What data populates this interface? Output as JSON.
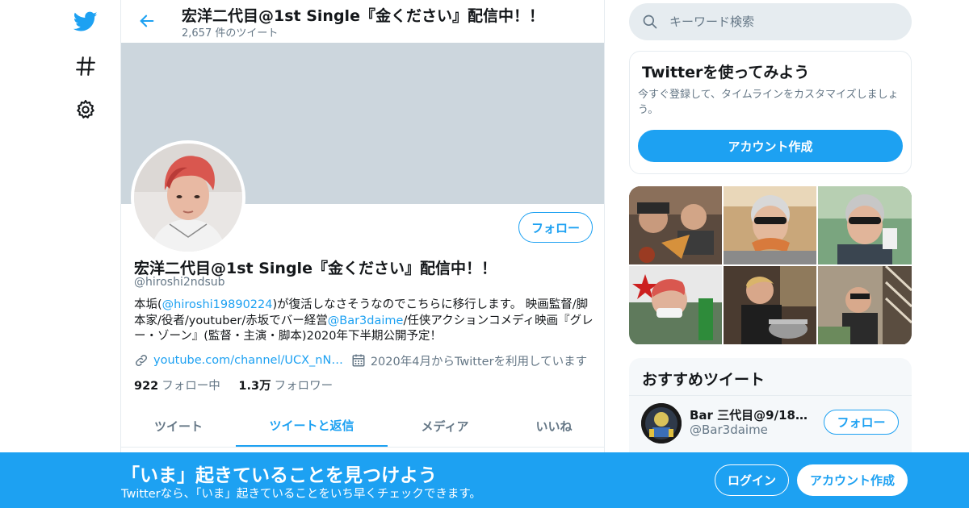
{
  "colors": {
    "accent": "#1da1f2",
    "text_primary": "#14171a",
    "text_secondary": "#657786",
    "banner": "#ccd6dd",
    "border": "#e6ecf0"
  },
  "nav": {
    "items": [
      {
        "icon": "twitter-bird-icon"
      },
      {
        "icon": "hashtag-icon"
      },
      {
        "icon": "gear-icon"
      }
    ]
  },
  "header": {
    "title": "宏洋二代目@1st Single『金ください』配信中！！",
    "tweet_count": "2,657 件のツイート"
  },
  "profile": {
    "name": "宏洋二代目@1st Single『金ください』配信中！！",
    "handle": "@hiroshi2ndsub",
    "follow_label": "フォロー",
    "bio": {
      "p1": "本垢(",
      "mention1": "@hiroshi19890224",
      "p2": ")が復活しなさそうなのでこちらに移行します。 映画監督/脚本家/役者/youtuber/赤坂でバー経営",
      "mention2": "@Bar3daime",
      "p3": "/任侠アクションコメディ映画『グレー・ゾーン』(監督・主演・脚本)2020年下半期公開予定！"
    },
    "link": "youtube.com/channel/UCX_nN…",
    "joined": "2020年4月からTwitterを利用しています",
    "following_count": "922",
    "following_label": "フォロー中",
    "followers_count": "1.3万",
    "followers_label": "フォロワー"
  },
  "tabs": [
    {
      "label": "ツイート",
      "active": false
    },
    {
      "label": "ツイートと返信",
      "active": true
    },
    {
      "label": "メディア",
      "active": false
    },
    {
      "label": "いいね",
      "active": false
    }
  ],
  "search": {
    "placeholder": "キーワード検索"
  },
  "signup_card": {
    "title": "Twitterを使ってみよう",
    "description": "今すぐ登録して、タイムラインをカスタマイズしましょう。",
    "button": "アカウント作成"
  },
  "recommended": {
    "title": "おすすめツイート",
    "account": {
      "name": "Bar 三代目@9/18退...",
      "handle": "@Bar3daime",
      "follow_label": "フォロー"
    }
  },
  "bottom_bar": {
    "title": "「いま」起きていることを見つけよう",
    "subtitle": "Twitterなら、「いま」起きていることをいち早くチェックできます。",
    "login": "ログイン",
    "signup": "アカウント作成"
  }
}
